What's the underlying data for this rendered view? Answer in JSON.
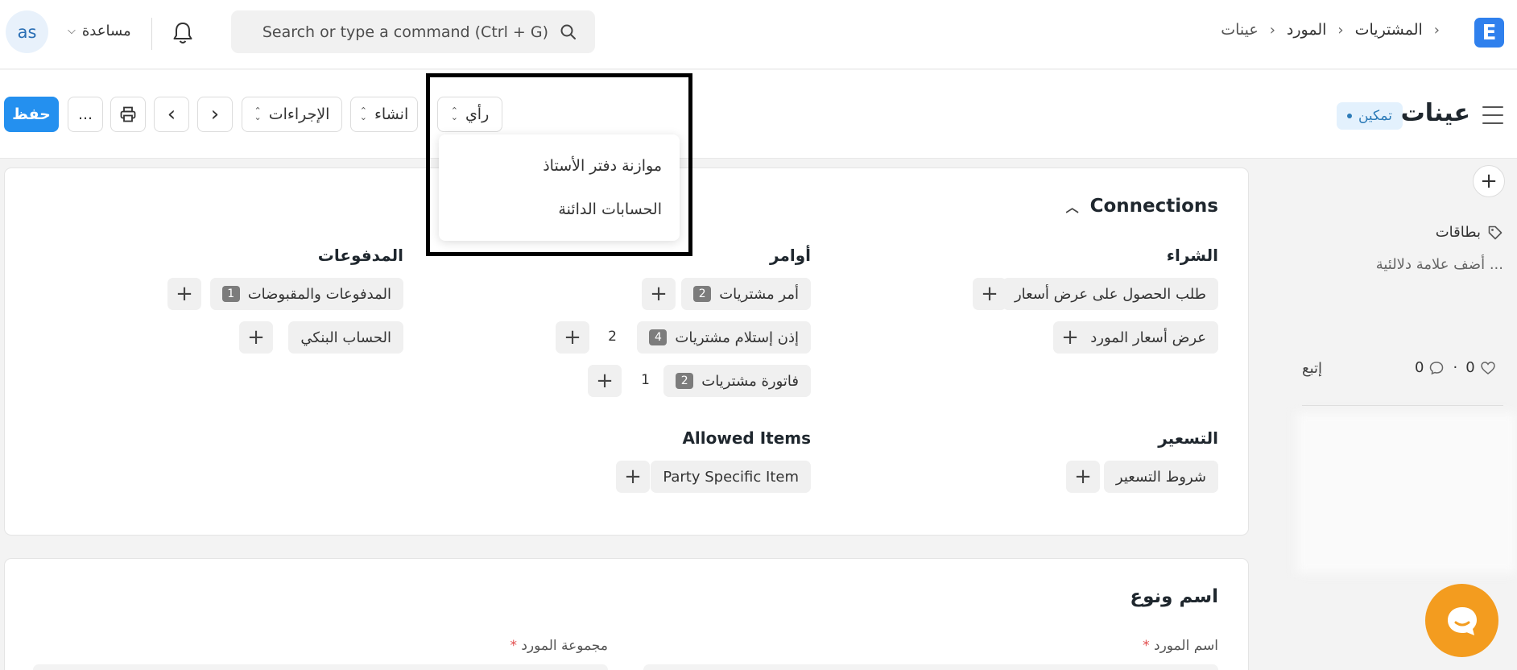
{
  "navbar": {
    "avatar_initials": "as",
    "help_label": "مساعدة",
    "search_placeholder": "Search or type a command (Ctrl + G)",
    "logo_letter": "E",
    "breadcrumb": [
      "المشتريات",
      "المورد",
      "عينات"
    ]
  },
  "page": {
    "title": "عينات",
    "status": "تمكين",
    "buttons": {
      "save": "حفظ",
      "more": "...",
      "actions": "الإجراءات",
      "create": "انشاء",
      "view": "رأي"
    }
  },
  "view_dropdown": {
    "items": [
      "موازنة دفتر الأستاذ",
      "الحسابات الدائنة"
    ]
  },
  "connections": {
    "title": "Connections",
    "groups": {
      "purchase": {
        "title": "الشراء",
        "items": [
          "طلب الحصول على عرض أسعار",
          "عرض أسعار المورد"
        ]
      },
      "orders": {
        "title": "أوامر",
        "items": [
          {
            "label": "أمر مشتريات",
            "count": "2",
            "open": ""
          },
          {
            "label": "إذن إستلام مشتريات",
            "count": "4",
            "open": "2"
          },
          {
            "label": "فاتورة مشتريات",
            "count": "2",
            "open": "1"
          }
        ]
      },
      "payments": {
        "title": "المدفوعات",
        "items": [
          {
            "label": "المدفوعات والمقبوضات",
            "count": "1"
          },
          {
            "label": "الحساب البنكي",
            "count": ""
          }
        ]
      },
      "pricing": {
        "title": "التسعير",
        "items": [
          "شروط التسعير"
        ]
      },
      "allowed": {
        "title": "Allowed Items",
        "items": [
          "Party Specific Item"
        ]
      }
    }
  },
  "sidebar": {
    "tags_label": "بطاقات",
    "add_tag": "أضف علامة دلالئية ...",
    "likes": "0",
    "comments": "0",
    "follow": "إتبع"
  },
  "name_section": {
    "title": "اسم ونوع",
    "supplier_name_label": "اسم المورد",
    "supplier_group_label": "مجموعة المورد",
    "required_mark": "*"
  },
  "colors": {
    "primary": "#2490ef",
    "badge_bg": "#e3f1fd",
    "chat": "#f39c1f"
  }
}
